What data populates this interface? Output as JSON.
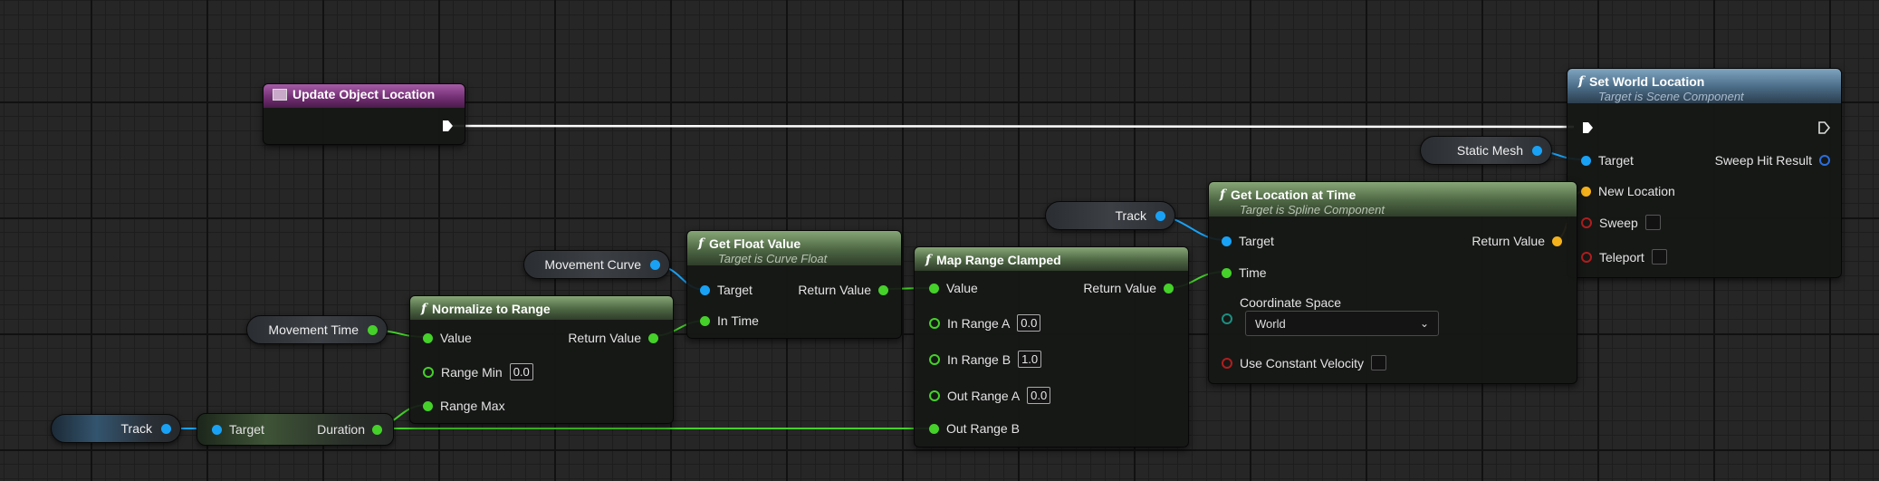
{
  "nodes": {
    "event": {
      "title": "Update Object Location"
    },
    "set_world_location": {
      "title": "Set World Location",
      "subtitle": "Target is Scene Component",
      "pins": {
        "target": "Target",
        "sweep_hit_result": "Sweep Hit Result",
        "new_location": "New Location",
        "sweep": "Sweep",
        "teleport": "Teleport"
      }
    },
    "get_location_at_time": {
      "title": "Get Location at Time",
      "subtitle": "Target is Spline Component",
      "pins": {
        "target": "Target",
        "return_value": "Return Value",
        "time": "Time",
        "coordinate_space": "Coordinate Space",
        "coordinate_space_value": "World",
        "use_constant_velocity": "Use Constant Velocity"
      }
    },
    "get_float_value": {
      "title": "Get Float Value",
      "subtitle": "Target is Curve Float",
      "pins": {
        "target": "Target",
        "return_value": "Return Value",
        "in_time": "In Time"
      }
    },
    "map_range_clamped": {
      "title": "Map Range Clamped",
      "pins": {
        "value": "Value",
        "return_value": "Return Value",
        "in_range_a": "In Range A",
        "in_range_a_val": "0.0",
        "in_range_b": "In Range B",
        "in_range_b_val": "1.0",
        "out_range_a": "Out Range A",
        "out_range_a_val": "0.0",
        "out_range_b": "Out Range B"
      }
    },
    "normalize_to_range": {
      "title": "Normalize to Range",
      "pins": {
        "value": "Value",
        "return_value": "Return Value",
        "range_min": "Range Min",
        "range_min_val": "0.0",
        "range_max": "Range Max"
      }
    },
    "duration_getter": {
      "target": "Target",
      "duration": "Duration"
    }
  },
  "variables": {
    "static_mesh": "Static Mesh",
    "track_top": "Track",
    "movement_curve": "Movement Curve",
    "movement_time": "Movement Time",
    "track_bottom": "Track"
  },
  "colors": {
    "float_pin": "#46d02a",
    "object_pin": "#19a2f5",
    "vector_pin": "#f4b11b",
    "bool_pin": "#b01e1e",
    "exec_wire": "#ffffff",
    "event_header": "#6f2d70",
    "function_header_green": "#4d6643",
    "function_header_blue": "#496a85"
  }
}
